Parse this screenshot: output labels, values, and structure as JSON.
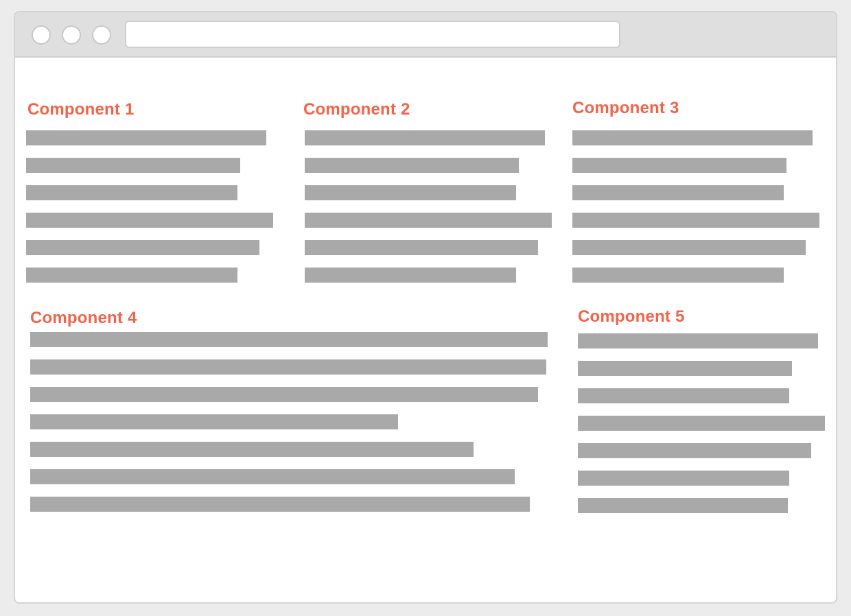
{
  "colors": {
    "heading": "#f2644a",
    "bar": "#a9a9a9",
    "page_background": "#ececec",
    "window_background": "#ffffff",
    "titlebar": "#dfdfdf"
  },
  "window": {
    "traffic_lights": [
      "window-control",
      "window-control",
      "window-control"
    ],
    "address_bar_value": ""
  },
  "components": [
    {
      "title": "Component 1",
      "placeholder_lines": 6
    },
    {
      "title": "Component 2",
      "placeholder_lines": 6
    },
    {
      "title": "Component 3",
      "placeholder_lines": 6
    },
    {
      "title": "Component 4",
      "placeholder_lines": 7
    },
    {
      "title": "Component 5",
      "placeholder_lines": 7
    }
  ]
}
